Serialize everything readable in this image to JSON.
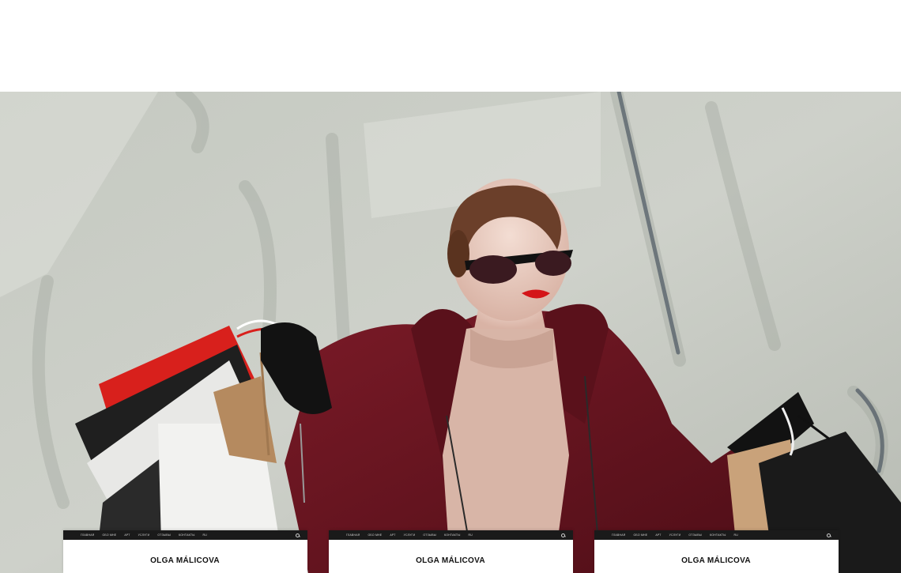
{
  "hero": {
    "alt": "Woman in sunglasses and burgundy coat holding shopping bags"
  },
  "cards": [
    {
      "nav": [
        "ГЛАВНАЯ",
        "ОБО МНЕ",
        "АРТ",
        "УСЛУГИ",
        "ОТЗЫВЫ",
        "КОНТАКТЫ",
        "RU"
      ],
      "title": "OLGA MÁLICOVA"
    },
    {
      "nav": [
        "ГЛАВНАЯ",
        "ОБО МНЕ",
        "АРТ",
        "УСЛУГИ",
        "ОТЗЫВЫ",
        "КОНТАКТЫ",
        "RU"
      ],
      "title": "OLGA MÁLICOVA"
    },
    {
      "nav": [
        "ГЛАВНАЯ",
        "ОБО МНЕ",
        "АРТ",
        "УСЛУГИ",
        "ОТЗЫВЫ",
        "КОНТАКТЫ",
        "RU"
      ],
      "title": "OLGA MÁLICOVA"
    }
  ],
  "colors": {
    "wall": "#c9ccc4",
    "coat": "#6e1622",
    "sweater": "#d9b6a8",
    "bag_red": "#d8201c",
    "bag_black": "#1e1e1e",
    "nav_bar": "#1a1a1a"
  }
}
